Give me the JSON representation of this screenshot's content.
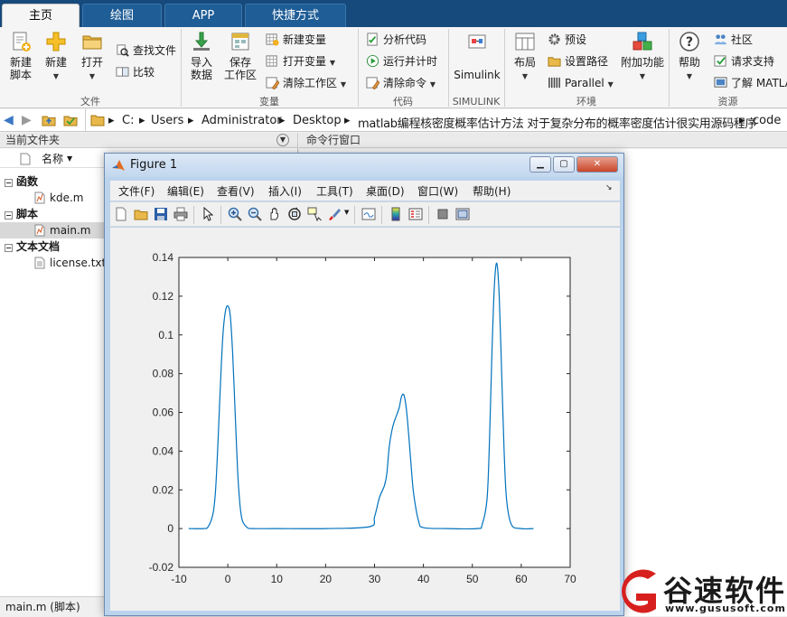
{
  "tabs": [
    {
      "label": "主页",
      "active": true
    },
    {
      "label": "绘图",
      "active": false
    },
    {
      "label": "APP",
      "active": false
    },
    {
      "label": "快捷方式",
      "active": false
    }
  ],
  "ribbon": {
    "file": {
      "group": "文件",
      "new_script": "新建\n脚本",
      "new": "新建",
      "open": "打开",
      "find_files": "查找文件",
      "compare": "比较"
    },
    "variable": {
      "group": "变量",
      "import": "导入\n数据",
      "save_ws": "保存\n工作区",
      "new_var": "新建变量",
      "open_var": "打开变量",
      "clear_ws": "清除工作区"
    },
    "code": {
      "group": "代码",
      "analyze": "分析代码",
      "run_time": "运行并计时",
      "clear_cmd": "清除命令"
    },
    "simulink": {
      "group": "SIMULINK",
      "simulink": "Simulink"
    },
    "env": {
      "group": "环境",
      "layout": "布局",
      "prefs": "预设",
      "set_path": "设置路径",
      "parallel": "Parallel",
      "addons": "附加功能"
    },
    "resources": {
      "group": "资源",
      "help": "帮助",
      "community": "社区",
      "support": "请求支持",
      "learn": "了解 MATLAB"
    }
  },
  "address": {
    "crumbs": [
      "C:",
      "Users",
      "Administrator",
      "Desktop",
      "matlab编程核密度概率估计方法 对于复杂分布的概率密度估计很实用源码程序",
      "code"
    ]
  },
  "left_panel": {
    "header": "当前文件夹",
    "column": "名称",
    "tree": [
      {
        "type": "group",
        "label": "函数"
      },
      {
        "type": "file",
        "label": "kde.m",
        "icon": "m-file-icon"
      },
      {
        "type": "group",
        "label": "脚本"
      },
      {
        "type": "file",
        "label": "main.m",
        "icon": "m-file-icon",
        "selected": true
      },
      {
        "type": "group",
        "label": "文本文档"
      },
      {
        "type": "file",
        "label": "license.txt",
        "icon": "text-file-icon"
      }
    ],
    "status": "main.m  (脚本)"
  },
  "command_window": {
    "header": "命令行窗口"
  },
  "figure": {
    "title": "Figure 1",
    "menus": [
      "文件(F)",
      "编辑(E)",
      "查看(V)",
      "插入(I)",
      "工具(T)",
      "桌面(D)",
      "窗口(W)",
      "帮助(H)"
    ],
    "toolbar_icons": [
      "new-figure-icon",
      "open-file-icon",
      "save-icon",
      "print-icon",
      "pointer-icon",
      "zoom-in-icon",
      "zoom-out-icon",
      "pan-icon",
      "rotate-icon",
      "data-cursor-icon",
      "brush-icon",
      "link-icon",
      "colorbar-icon",
      "legend-icon",
      "hide-plot-tools-icon",
      "show-plot-tools-icon"
    ]
  },
  "chart_data": {
    "type": "line",
    "title": "",
    "xlabel": "",
    "ylabel": "",
    "xlim": [
      -10,
      70
    ],
    "ylim": [
      -0.02,
      0.14
    ],
    "xticks": [
      -10,
      0,
      10,
      20,
      30,
      40,
      50,
      60,
      70
    ],
    "yticks": [
      -0.02,
      0,
      0.02,
      0.04,
      0.06,
      0.08,
      0.1,
      0.12,
      0.14
    ],
    "ytick_labels": [
      "-0.02",
      "0",
      "0.02",
      "0.04",
      "0.06",
      "0.08",
      "0.1",
      "0.12",
      "0.14"
    ],
    "grid": false,
    "color": "#0072bd",
    "x": [
      -8,
      -5,
      -4,
      -3,
      -2.5,
      -2,
      -1.5,
      -1,
      -0.5,
      0,
      0.5,
      1,
      1.5,
      2,
      2.5,
      3,
      4,
      5,
      10,
      20,
      29,
      30,
      31,
      32,
      32.5,
      33,
      33.5,
      34,
      35,
      35.5,
      36,
      36.5,
      37,
      37.5,
      38,
      39,
      40,
      45,
      51,
      52,
      53,
      53.5,
      54,
      54.5,
      55,
      55.5,
      56,
      56.5,
      57,
      58,
      60,
      62.5
    ],
    "y": [
      0,
      0,
      0.001,
      0.008,
      0.02,
      0.045,
      0.075,
      0.1,
      0.112,
      0.115,
      0.11,
      0.09,
      0.06,
      0.03,
      0.012,
      0.004,
      0.0005,
      0,
      0,
      0,
      0.001,
      0.006,
      0.016,
      0.022,
      0.028,
      0.042,
      0.05,
      0.055,
      0.062,
      0.068,
      0.069,
      0.062,
      0.048,
      0.032,
      0.018,
      0.004,
      0.0005,
      0,
      0,
      0.002,
      0.015,
      0.045,
      0.09,
      0.125,
      0.137,
      0.12,
      0.08,
      0.04,
      0.015,
      0.002,
      0,
      0
    ]
  },
  "watermark": {
    "brand": "谷速软件",
    "url": "www.gususoft.com",
    "accent": "#d7201e"
  }
}
